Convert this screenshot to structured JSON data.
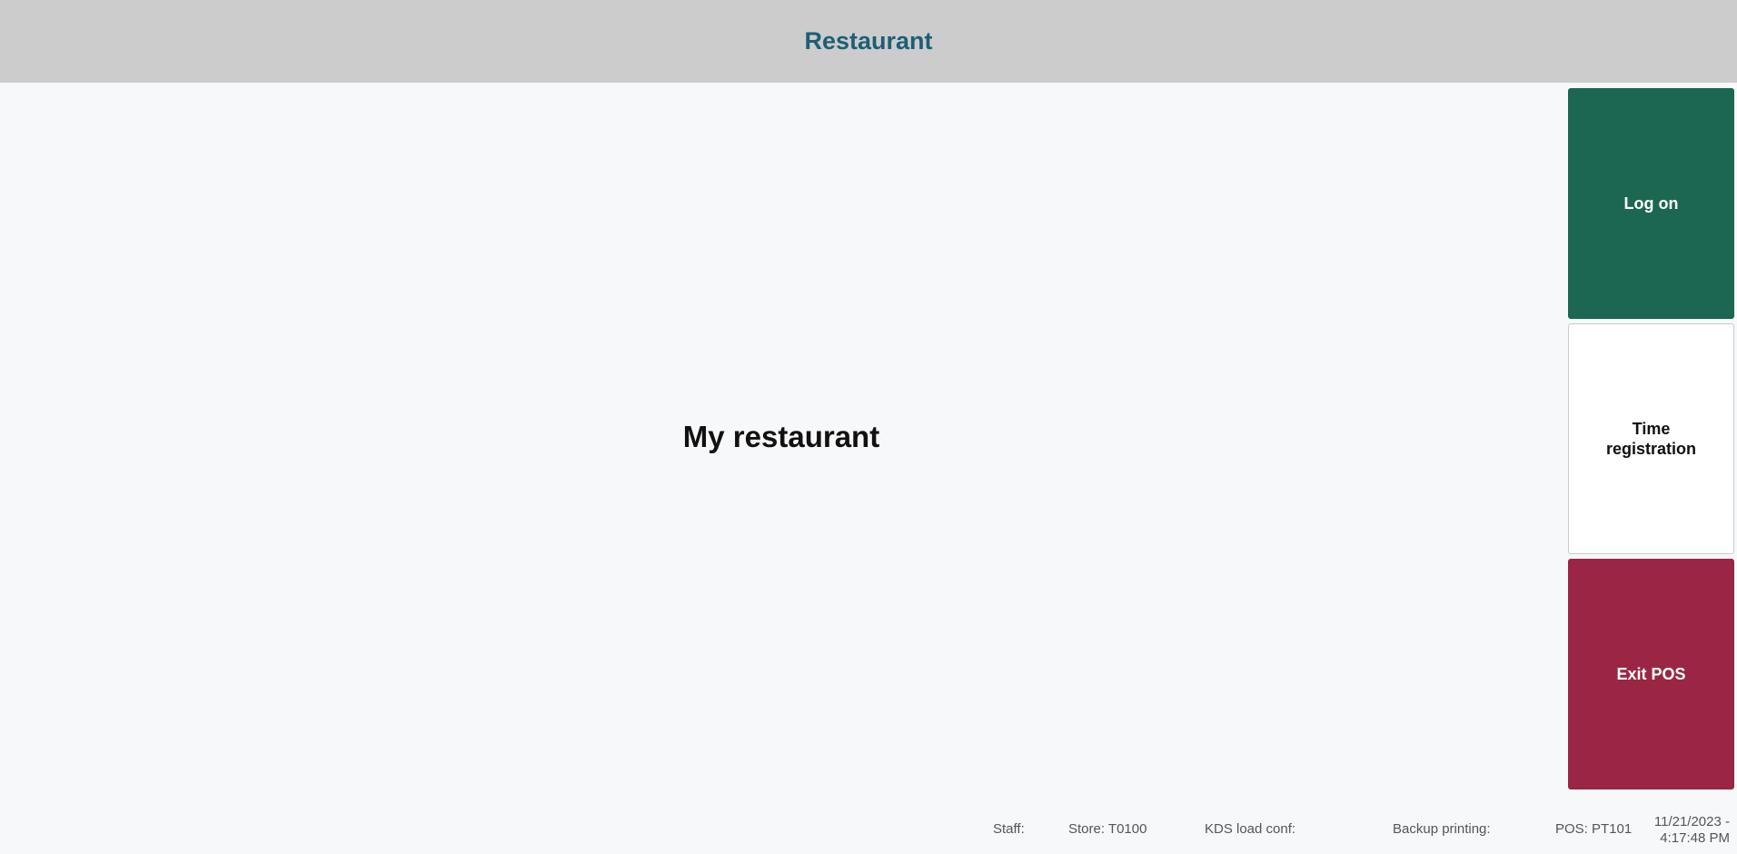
{
  "header": {
    "title": "Restaurant"
  },
  "main": {
    "title": "My restaurant"
  },
  "actions": {
    "log_on": "Log on",
    "time_registration": "Time registration",
    "exit_pos": "Exit POS"
  },
  "status_bar": {
    "staff": "Staff:",
    "store": "Store: T0100",
    "kds_load_conf": "KDS load conf:",
    "backup_printing": "Backup printing:",
    "pos": "POS: PT101",
    "date": "11/21/2023 -",
    "time": "4:17:48 PM"
  },
  "colors": {
    "header_bg": "#cccccc",
    "header_text": "#1c5f75",
    "log_on_bg": "#1b6752",
    "exit_bg": "#9a2643",
    "page_bg": "#f7f8fa"
  }
}
